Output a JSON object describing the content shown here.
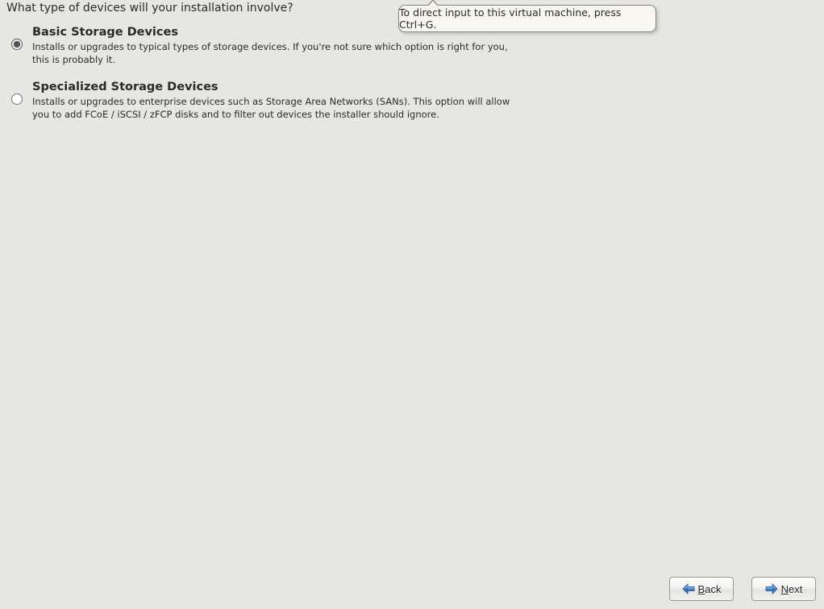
{
  "question": "What type of devices will your installation involve?",
  "options": {
    "basic": {
      "title": "Basic Storage Devices",
      "desc": "Installs or upgrades to typical types of storage devices.  If you're not sure which option is right for you, this is probably it.",
      "selected": true
    },
    "specialized": {
      "title": "Specialized Storage Devices",
      "desc": "Installs or upgrades to enterprise devices such as Storage Area Networks (SANs). This option will allow you to add FCoE / iSCSI / zFCP disks and to filter out devices the installer should ignore.",
      "selected": false
    }
  },
  "tooltip": "To direct input to this virtual machine, press Ctrl+G.",
  "buttons": {
    "back": {
      "accel": "B",
      "rest": "ack"
    },
    "next": {
      "accel": "N",
      "rest": "ext"
    }
  }
}
